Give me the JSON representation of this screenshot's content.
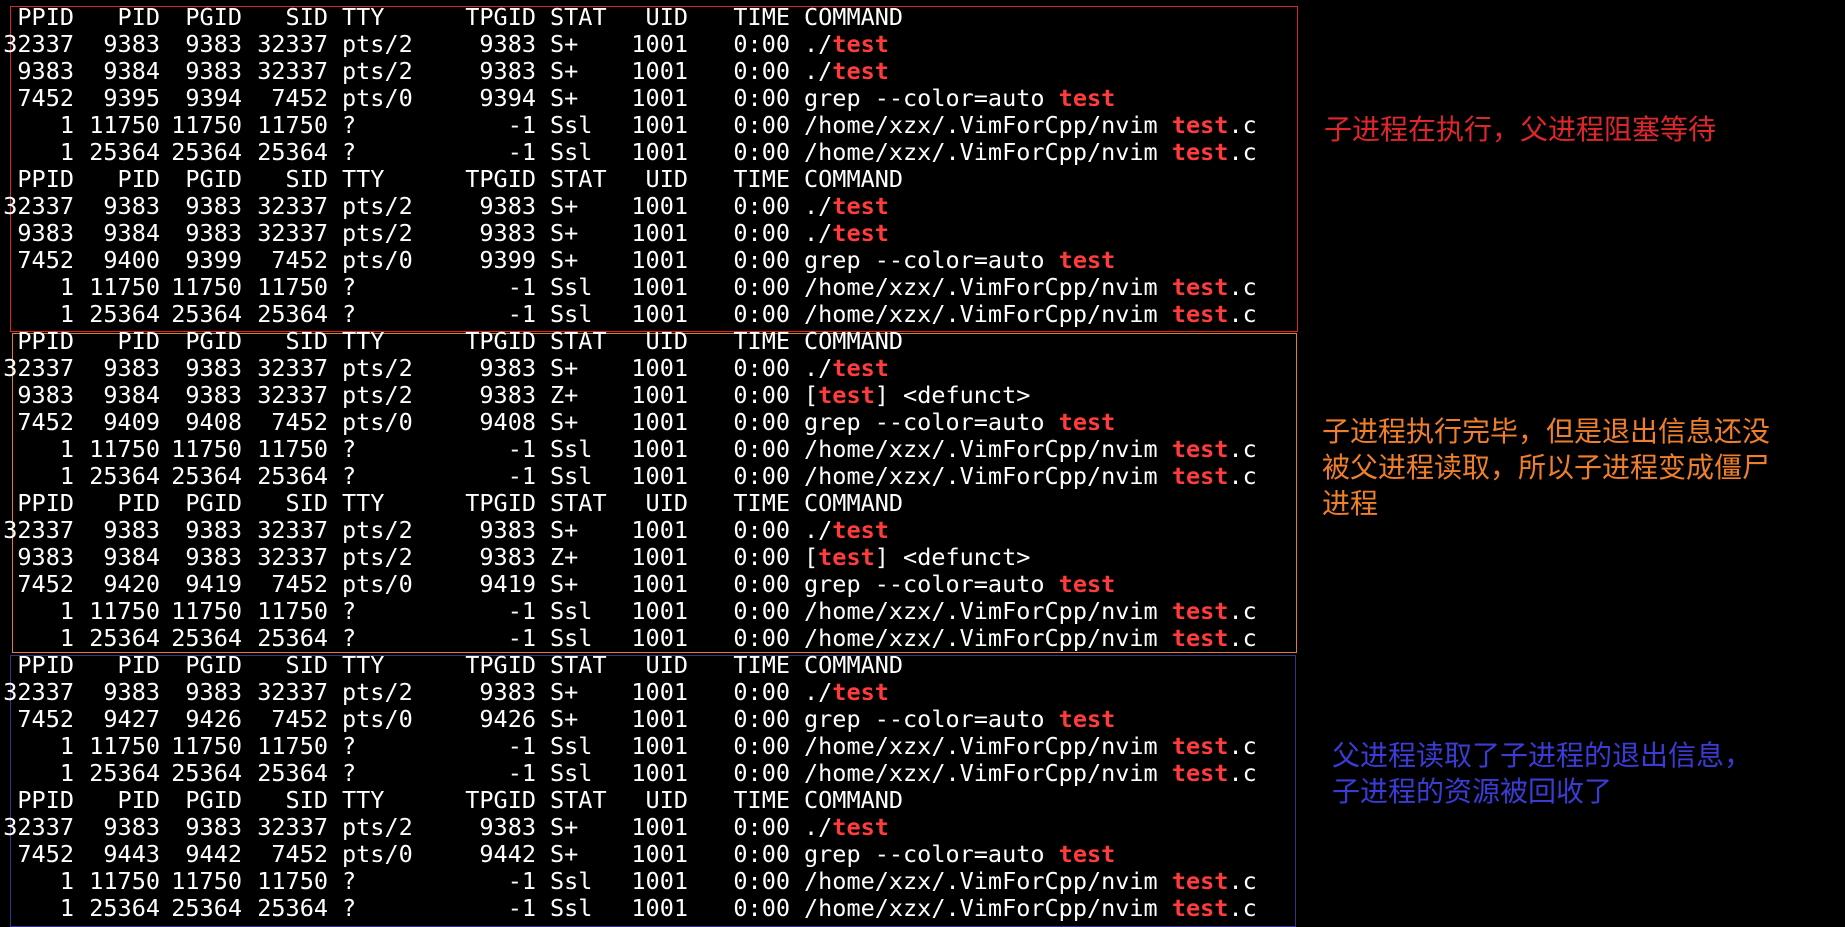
{
  "header": [
    "PPID",
    "PID",
    "PGID",
    "SID",
    "TTY",
    "TPGID",
    "STAT",
    "UID",
    "TIME",
    "COMMAND"
  ],
  "highlight_word": "test",
  "colors": {
    "background": "#000000",
    "text": "#ffffff",
    "highlight": "#ff3b3b",
    "box_red": "#d8232a",
    "box_orange": "#e8792a",
    "box_blue": "#33338f",
    "note_red": "#e0262d",
    "note_orange": "#ef7f2a",
    "note_blue": "#3b3bd6"
  },
  "blocks": [
    {
      "box": "red",
      "rows": [
        [
          "32337",
          "9383",
          "9383",
          "32337",
          "pts/2",
          "9383",
          "S+",
          "1001",
          "0:00",
          "./test"
        ],
        [
          "9383",
          "9384",
          "9383",
          "32337",
          "pts/2",
          "9383",
          "S+",
          "1001",
          "0:00",
          "./test"
        ],
        [
          "7452",
          "9395",
          "9394",
          "7452",
          "pts/0",
          "9394",
          "S+",
          "1001",
          "0:00",
          "grep --color=auto test"
        ],
        [
          "1",
          "11750",
          "11750",
          "11750",
          "?",
          "-1",
          "Ssl",
          "1001",
          "0:00",
          "/home/xzx/.VimForCpp/nvim test.c"
        ],
        [
          "1",
          "25364",
          "25364",
          "25364",
          "?",
          "-1",
          "Ssl",
          "1001",
          "0:00",
          "/home/xzx/.VimForCpp/nvim test.c"
        ]
      ]
    },
    {
      "box": "red",
      "rows": [
        [
          "32337",
          "9383",
          "9383",
          "32337",
          "pts/2",
          "9383",
          "S+",
          "1001",
          "0:00",
          "./test"
        ],
        [
          "9383",
          "9384",
          "9383",
          "32337",
          "pts/2",
          "9383",
          "S+",
          "1001",
          "0:00",
          "./test"
        ],
        [
          "7452",
          "9400",
          "9399",
          "7452",
          "pts/0",
          "9399",
          "S+",
          "1001",
          "0:00",
          "grep --color=auto test"
        ],
        [
          "1",
          "11750",
          "11750",
          "11750",
          "?",
          "-1",
          "Ssl",
          "1001",
          "0:00",
          "/home/xzx/.VimForCpp/nvim test.c"
        ],
        [
          "1",
          "25364",
          "25364",
          "25364",
          "?",
          "-1",
          "Ssl",
          "1001",
          "0:00",
          "/home/xzx/.VimForCpp/nvim test.c"
        ]
      ]
    },
    {
      "box": "orange",
      "rows": [
        [
          "32337",
          "9383",
          "9383",
          "32337",
          "pts/2",
          "9383",
          "S+",
          "1001",
          "0:00",
          "./test"
        ],
        [
          "9383",
          "9384",
          "9383",
          "32337",
          "pts/2",
          "9383",
          "Z+",
          "1001",
          "0:00",
          "[test] <defunct>"
        ],
        [
          "7452",
          "9409",
          "9408",
          "7452",
          "pts/0",
          "9408",
          "S+",
          "1001",
          "0:00",
          "grep --color=auto test"
        ],
        [
          "1",
          "11750",
          "11750",
          "11750",
          "?",
          "-1",
          "Ssl",
          "1001",
          "0:00",
          "/home/xzx/.VimForCpp/nvim test.c"
        ],
        [
          "1",
          "25364",
          "25364",
          "25364",
          "?",
          "-1",
          "Ssl",
          "1001",
          "0:00",
          "/home/xzx/.VimForCpp/nvim test.c"
        ]
      ]
    },
    {
      "box": "orange",
      "rows": [
        [
          "32337",
          "9383",
          "9383",
          "32337",
          "pts/2",
          "9383",
          "S+",
          "1001",
          "0:00",
          "./test"
        ],
        [
          "9383",
          "9384",
          "9383",
          "32337",
          "pts/2",
          "9383",
          "Z+",
          "1001",
          "0:00",
          "[test] <defunct>"
        ],
        [
          "7452",
          "9420",
          "9419",
          "7452",
          "pts/0",
          "9419",
          "S+",
          "1001",
          "0:00",
          "grep --color=auto test"
        ],
        [
          "1",
          "11750",
          "11750",
          "11750",
          "?",
          "-1",
          "Ssl",
          "1001",
          "0:00",
          "/home/xzx/.VimForCpp/nvim test.c"
        ],
        [
          "1",
          "25364",
          "25364",
          "25364",
          "?",
          "-1",
          "Ssl",
          "1001",
          "0:00",
          "/home/xzx/.VimForCpp/nvim test.c"
        ]
      ]
    },
    {
      "box": "blue",
      "rows": [
        [
          "32337",
          "9383",
          "9383",
          "32337",
          "pts/2",
          "9383",
          "S+",
          "1001",
          "0:00",
          "./test"
        ],
        [
          "7452",
          "9427",
          "9426",
          "7452",
          "pts/0",
          "9426",
          "S+",
          "1001",
          "0:00",
          "grep --color=auto test"
        ],
        [
          "1",
          "11750",
          "11750",
          "11750",
          "?",
          "-1",
          "Ssl",
          "1001",
          "0:00",
          "/home/xzx/.VimForCpp/nvim test.c"
        ],
        [
          "1",
          "25364",
          "25364",
          "25364",
          "?",
          "-1",
          "Ssl",
          "1001",
          "0:00",
          "/home/xzx/.VimForCpp/nvim test.c"
        ]
      ]
    },
    {
      "box": "blue",
      "rows": [
        [
          "32337",
          "9383",
          "9383",
          "32337",
          "pts/2",
          "9383",
          "S+",
          "1001",
          "0:00",
          "./test"
        ],
        [
          "7452",
          "9443",
          "9442",
          "7452",
          "pts/0",
          "9442",
          "S+",
          "1001",
          "0:00",
          "grep --color=auto test"
        ],
        [
          "1",
          "11750",
          "11750",
          "11750",
          "?",
          "-1",
          "Ssl",
          "1001",
          "0:00",
          "/home/xzx/.VimForCpp/nvim test.c"
        ],
        [
          "1",
          "25364",
          "25364",
          "25364",
          "?",
          "-1",
          "Ssl",
          "1001",
          "0:00",
          "/home/xzx/.VimForCpp/nvim test.c"
        ]
      ]
    }
  ],
  "annotations": {
    "red": [
      "子进程在执行，父进程阻塞等待"
    ],
    "orange": [
      "子进程执行完毕，但是退出信息还没",
      "被父进程读取，所以子进程变成僵尸",
      "进程"
    ],
    "blue": [
      "父进程读取了子进程的退出信息，",
      "子进程的资源被回收了"
    ]
  }
}
